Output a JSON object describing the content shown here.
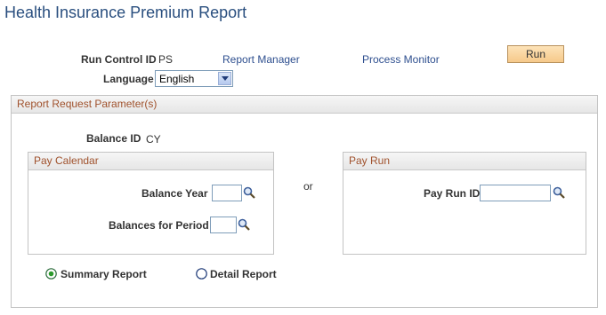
{
  "page": {
    "title": "Health Insurance Premium Report"
  },
  "header": {
    "run_control_label": "Run Control ID",
    "run_control_value": "PS",
    "report_manager_link": "Report Manager",
    "process_monitor_link": "Process Monitor",
    "run_button": "Run",
    "language_label": "Language",
    "language_value": "English"
  },
  "parameters": {
    "title": "Report Request Parameter(s)",
    "balance_id_label": "Balance ID",
    "balance_id_value": "CY",
    "or_text": "or",
    "pay_calendar": {
      "title": "Pay Calendar",
      "balance_year_label": "Balance Year",
      "balance_year_value": "",
      "balances_period_label": "Balances for Period",
      "balances_period_value": ""
    },
    "pay_run": {
      "title": "Pay Run",
      "pay_run_id_label": "Pay Run ID",
      "pay_run_id_value": ""
    },
    "report_type": {
      "summary_label": "Summary Report",
      "detail_label": "Detail Report",
      "selected": "summary"
    }
  },
  "colors": {
    "title": "#2a4f7f",
    "link": "#2e4f8f",
    "group_title": "#a0522d",
    "run_button": "#f6c98a"
  },
  "icons": {
    "lookup": "magnifier-icon",
    "dropdown": "chevron-down-icon",
    "radio_selected": "radio-selected-icon",
    "radio_unselected": "radio-unselected-icon"
  }
}
